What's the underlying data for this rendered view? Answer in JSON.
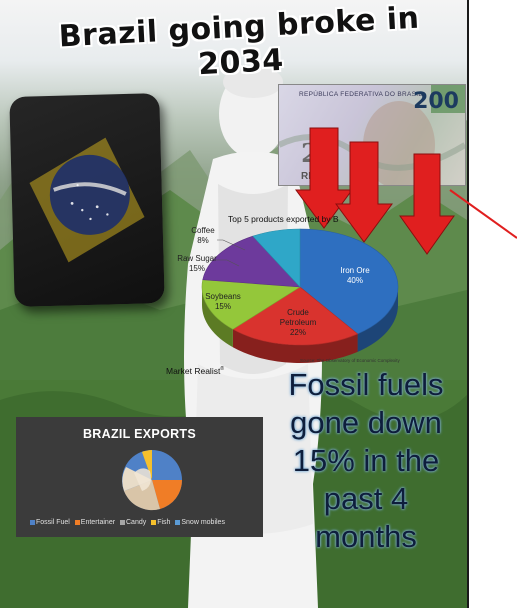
{
  "title": "Brazil going broke in 2034",
  "banknote": {
    "header": "REPÚBLICA FEDERATIVA DO BRASIL",
    "denomination": "200",
    "side_numeral": "2",
    "side_text": "RE"
  },
  "pie_chart": {
    "title": "Top 5 products exported by B",
    "slices": [
      {
        "name": "Iron Ore",
        "percent": "40%",
        "value": 40,
        "color": "#2e6fc0"
      },
      {
        "name": "Crude Petroleum",
        "percent": "22%",
        "value": 22,
        "color": "#d9332e"
      },
      {
        "name": "Soybeans",
        "percent": "15%",
        "value": 15,
        "color": "#94c73a"
      },
      {
        "name": "Raw Sugar",
        "percent": "15%",
        "value": 15,
        "color": "#6d3a9c"
      },
      {
        "name": "Coffee",
        "percent": "8%",
        "value": 8,
        "color": "#2fa7c8"
      }
    ],
    "source_text": "Source: The Observatory of Economic Complexity",
    "credit": "Market Realist"
  },
  "statement": [
    "Fossil fuels",
    "gone down",
    "15% in the",
    "past 4",
    "months"
  ],
  "exports_chart": {
    "title": "BRAZIL EXPORTS",
    "legend": [
      {
        "name": "Fossil Fuel",
        "color": "#4f81c7"
      },
      {
        "name": "Entertainer",
        "color": "#f07d26"
      },
      {
        "name": "Candy",
        "color": "#a5a5a5"
      },
      {
        "name": "Fish",
        "color": "#f5c02c"
      },
      {
        "name": "Snow mobiles",
        "color": "#5b9bd5"
      }
    ]
  },
  "chart_data": [
    {
      "type": "pie",
      "title": "Top 5 products exported by B",
      "categories": [
        "Iron Ore",
        "Crude Petroleum",
        "Soybeans",
        "Raw Sugar",
        "Coffee"
      ],
      "values": [
        40,
        22,
        15,
        15,
        8
      ]
    },
    {
      "type": "pie",
      "title": "BRAZIL EXPORTS",
      "categories": [
        "Fossil Fuel",
        "Entertainer",
        "Candy",
        "Fish",
        "Snow mobiles"
      ],
      "values": []
    }
  ],
  "colors": {
    "arrow_red": "#e01f1f",
    "exports_bg": "#3b3b3b",
    "statement_text": "#0e1e3c"
  }
}
